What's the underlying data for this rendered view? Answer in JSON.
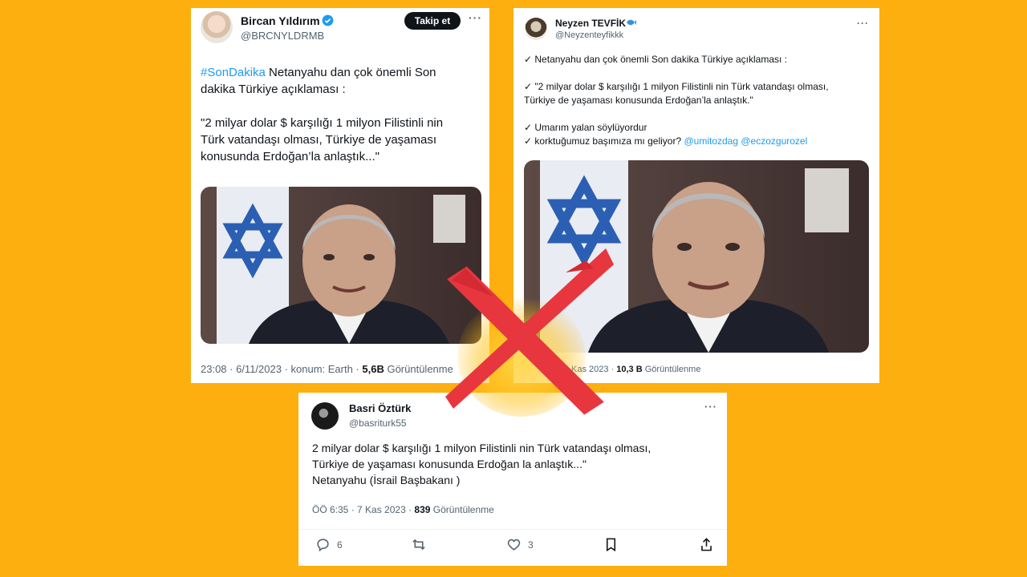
{
  "tweet1": {
    "name": "Bircan Yıldırım",
    "handle": "@BRCNYLDRMB",
    "follow_label": "Takip et",
    "hashtag": "#SonDakika",
    "line1_rest": " Netanyahu dan çok önemli Son",
    "line2": "dakika Türkiye açıklaması :",
    "line3": "\"2 milyar dolar $ karşılığı 1 milyon Filistinli nin",
    "line4": "Türk vatandaşı olması, Türkiye de yaşaması",
    "line5": "konusunda Erdoğan’la anlaştık...\"",
    "meta_time": "23:08 · 6/11/2023 · konum: Earth · ",
    "meta_views_count": "5,6B",
    "meta_views_label": " Görüntülenme"
  },
  "tweet2": {
    "name": "Neyzen TEVFİK",
    "handle": "@Neyzenteyfikkk",
    "line1": "✓ Netanyahu dan çok önemli Son dakika Türkiye açıklaması :",
    "line2": "✓ \"2 milyar dolar $ karşılığı 1 milyon Filistinli nin Türk vatandaşı olması,",
    "line3": "Türkiye de yaşaması konusunda Erdoğan’la anlaştık.\"",
    "line4": "✓ Umarım yalan söylüyordur",
    "line5_prefix": "✓ korktuğumuz başımıza mı geliyor? ",
    "mention1": "@umitozdag",
    "mention2": "@eczozgurozel",
    "meta_time": "Kas 2023 · ",
    "meta_views_count": "10,3 B",
    "meta_views_label": " Görüntülenme"
  },
  "tweet3": {
    "name": "Basri Öztürk",
    "handle": "@basriturk55",
    "line1": "2 milyar dolar $ karşılığı 1 milyon Filistinli nin Türk vatandaşı olması,",
    "line2": "Türkiye de yaşaması konusunda Erdoğan la anlaştık...\"",
    "line3": "Netanyahu (İsrail Başbakanı )",
    "meta_time": "ÖÖ 6:35 · 7 Kas 2023 · ",
    "meta_views_count": "839",
    "meta_views_label": " Görüntülenme",
    "replies": "6",
    "likes": "3"
  },
  "colors": {
    "background": "#FDAF0F",
    "link": "#1d9bf0",
    "cross": "#E8363F"
  }
}
